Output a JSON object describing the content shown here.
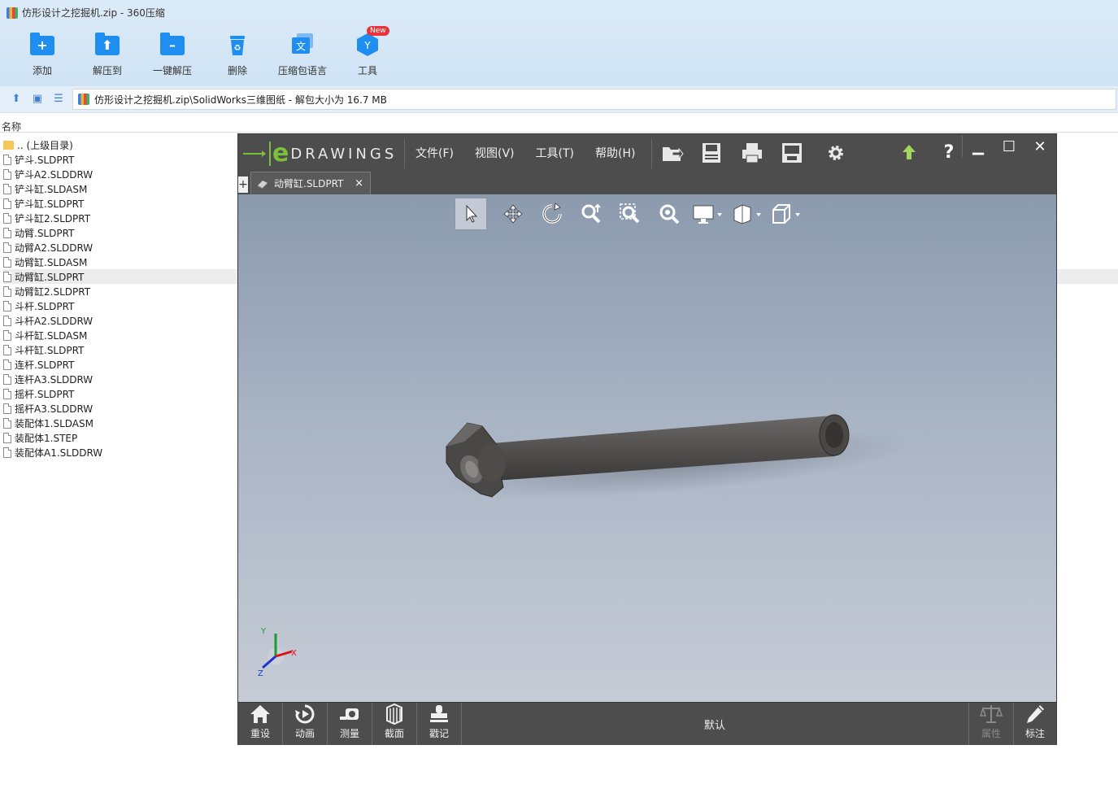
{
  "window": {
    "title": "仿形设计之挖掘机.zip - 360压缩"
  },
  "toolbar": {
    "add": "添加",
    "extract_to": "解压到",
    "one_click_extract": "一键解压",
    "delete": "删除",
    "language": "压缩包语言",
    "tools": "工具",
    "tools_badge": "New"
  },
  "address": {
    "path": "仿形设计之挖掘机.zip\\SolidWorks三维图纸 - 解包大小为 16.7 MB"
  },
  "list": {
    "column_name": "名称",
    "items": [
      ".. (上级目录)",
      "铲斗.SLDPRT",
      "铲斗A2.SLDDRW",
      "铲斗缸.SLDASM",
      "铲斗缸.SLDPRT",
      "铲斗缸2.SLDPRT",
      "动臂.SLDPRT",
      "动臂A2.SLDDRW",
      "动臂缸.SLDASM",
      "动臂缸.SLDPRT",
      "动臂缸2.SLDPRT",
      "斗杆.SLDPRT",
      "斗杆A2.SLDDRW",
      "斗杆缸.SLDASM",
      "斗杆缸.SLDPRT",
      "连杆.SLDPRT",
      "连杆A3.SLDDRW",
      "摇杆.SLDPRT",
      "摇杆A3.SLDDRW",
      "装配体1.SLDASM",
      "装配体1.STEP",
      "装配体A1.SLDDRW"
    ],
    "selected_index": 9
  },
  "edrawings": {
    "logo_word": "DRAWINGS",
    "menus": {
      "file": "文件(F)",
      "view": "视图(V)",
      "tools": "工具(T)",
      "help": "帮助(H)"
    },
    "tab": {
      "label": "动臂缸.SLDPRT",
      "plus": "+",
      "close": "×"
    },
    "triad": {
      "x": "X",
      "y": "Y",
      "z": "Z"
    },
    "bottom": {
      "reset": "重设",
      "animate": "动画",
      "measure": "测量",
      "section": "截面",
      "stamp": "戳记",
      "configuration": "默认",
      "properties": "属性",
      "markup": "标注"
    },
    "help_glyph": "?"
  },
  "colors": {
    "accent": "#1e8ef0",
    "edrawings_green": "#7bbf3a",
    "badge": "#e8323c"
  }
}
